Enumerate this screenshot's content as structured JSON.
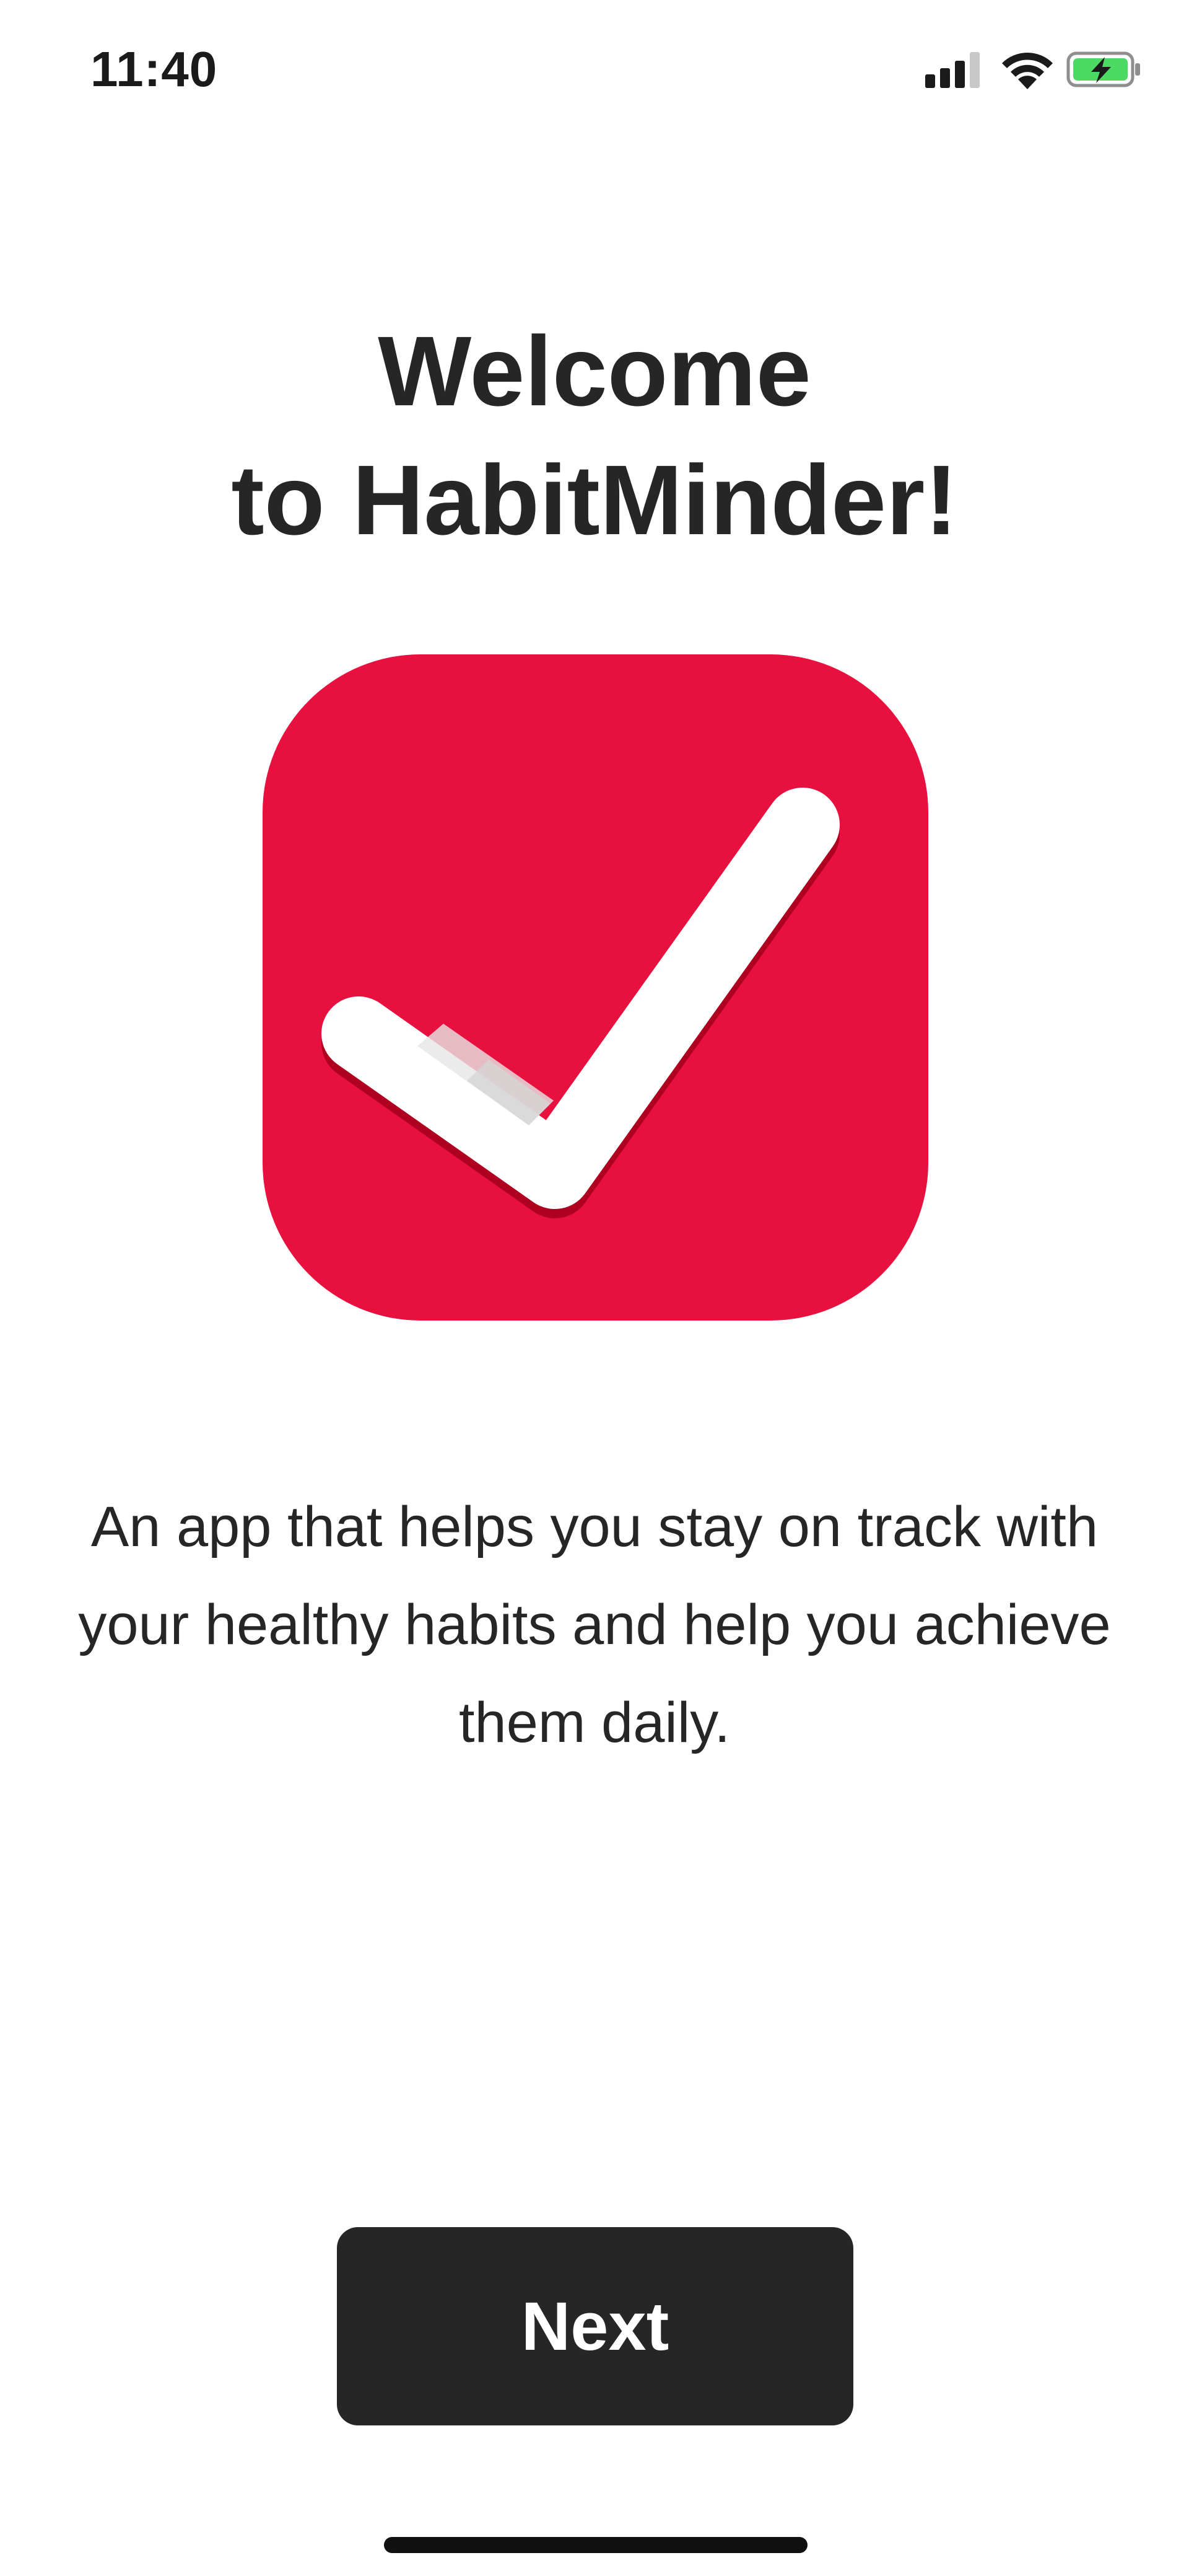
{
  "status_bar": {
    "time": "11:40",
    "icons": [
      "cellular-signal-icon",
      "wifi-icon",
      "battery-charging-icon"
    ]
  },
  "welcome": {
    "title_line1": "Welcome",
    "title_line2": "to HabitMinder!"
  },
  "app_icon": {
    "name": "habitminder-logo-icon",
    "background_color": "#E8103E",
    "check_color": "#FFFFFF",
    "shadow_color": "#B00020"
  },
  "description": "An app that helps you stay on track with your healthy habits and help you achieve them daily.",
  "next_button": {
    "label": "Next",
    "background_color": "#262626"
  },
  "colors": {
    "text": "#262626",
    "background": "#FFFFFF",
    "battery": "#4CD964"
  }
}
